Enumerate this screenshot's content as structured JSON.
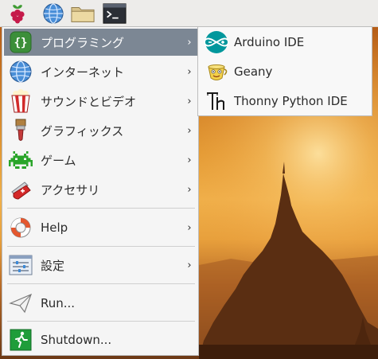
{
  "taskbar": {
    "buttons": [
      {
        "name": "raspberry-menu-icon"
      },
      {
        "name": "web-browser-icon"
      },
      {
        "name": "file-manager-icon"
      },
      {
        "name": "terminal-icon"
      }
    ]
  },
  "menu": {
    "items": [
      {
        "label": "プログラミング",
        "icon": "code-braces-icon",
        "has_submenu": true,
        "active": true
      },
      {
        "label": "インターネット",
        "icon": "globe-icon",
        "has_submenu": true
      },
      {
        "label": "サウンドとビデオ",
        "icon": "popcorn-icon",
        "has_submenu": true
      },
      {
        "label": "グラフィックス",
        "icon": "paintbrush-icon",
        "has_submenu": true
      },
      {
        "label": "ゲーム",
        "icon": "invader-icon",
        "has_submenu": true
      },
      {
        "label": "アクセサリ",
        "icon": "pocketknife-icon",
        "has_submenu": true
      },
      {
        "label": "Help",
        "icon": "lifebuoy-icon",
        "has_submenu": true
      },
      {
        "label": "設定",
        "icon": "settings-panel-icon",
        "has_submenu": true
      },
      {
        "label": "Run...",
        "icon": "paper-plane-icon",
        "has_submenu": false
      },
      {
        "label": "Shutdown...",
        "icon": "exit-icon",
        "has_submenu": false
      }
    ],
    "arrow_glyph": "›"
  },
  "submenu": {
    "items": [
      {
        "label": "Arduino IDE",
        "icon": "arduino-icon"
      },
      {
        "label": "Geany",
        "icon": "geany-icon"
      },
      {
        "label": "Thonny Python IDE",
        "icon": "thonny-icon"
      }
    ]
  },
  "colors": {
    "active_bg": "#7c8794",
    "menu_bg": "#f5f5f5",
    "arduino_teal": "#00979c",
    "sunset_orange": "#e39a34"
  }
}
